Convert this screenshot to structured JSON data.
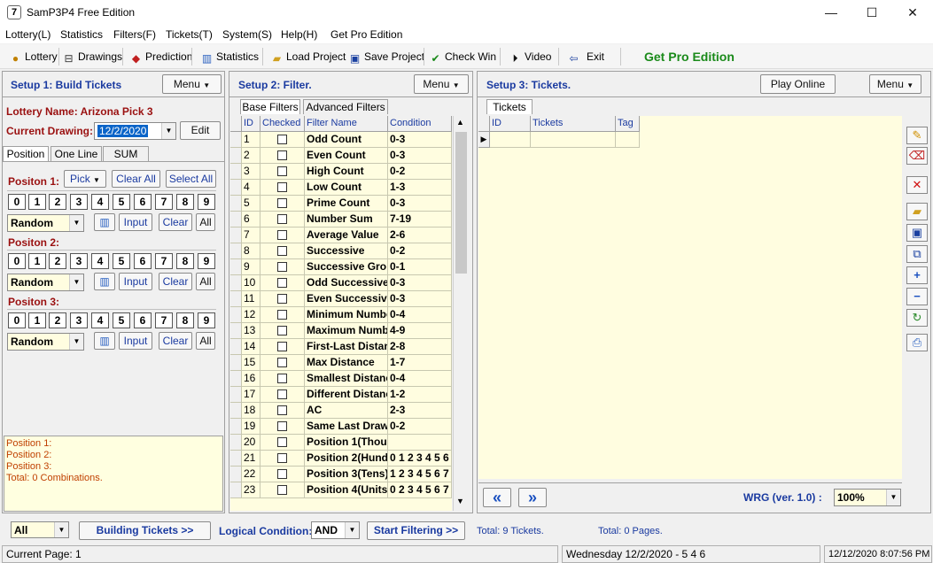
{
  "window": {
    "title": "SamP3P4 Free Edition",
    "minimize": "—",
    "maximize": "☐",
    "close": "✕"
  },
  "menu": [
    "Lottery(L)",
    "Statistics",
    "Filters(F)",
    "Tickets(T)",
    "System(S)",
    "Help(H)",
    "Get Pro Edition"
  ],
  "toolbar": {
    "lottery": "Lottery",
    "drawings": "Drawings",
    "prediction": "Prediction",
    "statistics": "Statistics",
    "load_project": "Load Project",
    "save_project": "Save Project",
    "check_win": "Check Win",
    "video": "Video",
    "exit": "Exit",
    "get_pro": "Get Pro Edition"
  },
  "setup1": {
    "header": "Setup 1: Build  Tickets",
    "menu_label": "Menu",
    "lottery_name": "Lottery  Name: Arizona Pick 3",
    "current_drawing_label": "Current Drawing:",
    "current_drawing_value": "12/2/2020",
    "edit_label": "Edit",
    "tabs": [
      "Position",
      "One Line",
      "SUM"
    ],
    "positions": [
      {
        "label": "Positon 1:",
        "pick": "Pick",
        "clear_all": "Clear All",
        "select_all": "Select All",
        "mode": "Random",
        "input": "Input",
        "clear": "Clear",
        "all": "All"
      },
      {
        "label": "Positon 2:",
        "mode": "Random",
        "input": "Input",
        "clear": "Clear",
        "all": "All"
      },
      {
        "label": "Positon 3:",
        "mode": "Random",
        "input": "Input",
        "clear": "Clear",
        "all": "All"
      }
    ],
    "digits": [
      "0",
      "1",
      "2",
      "3",
      "4",
      "5",
      "6",
      "7",
      "8",
      "9"
    ],
    "summary": [
      "Position 1:",
      "Position 2:",
      "Position 3:",
      "Total: 0 Combinations."
    ]
  },
  "setup2": {
    "header": "Setup 2: Filter.",
    "menu_label": "Menu",
    "tabs": [
      "Base Filters",
      "Advanced Filters"
    ],
    "columns": [
      "ID",
      "Checked",
      "Filter Name",
      "Condition"
    ],
    "rows": [
      [
        "1",
        "Odd Count",
        "0-3"
      ],
      [
        "2",
        "Even Count",
        "0-3"
      ],
      [
        "3",
        "High Count",
        "0-2"
      ],
      [
        "4",
        "Low Count",
        "1-3"
      ],
      [
        "5",
        "Prime Count",
        "0-3"
      ],
      [
        "6",
        "Number Sum",
        "7-19"
      ],
      [
        "7",
        "Average Value",
        "2-6"
      ],
      [
        "8",
        "Successive",
        "0-2"
      ],
      [
        "9",
        "Successive Gro",
        "0-1"
      ],
      [
        "10",
        "Odd Successive",
        "0-3"
      ],
      [
        "11",
        "Even Successiv",
        "0-3"
      ],
      [
        "12",
        "Minimum Numbe",
        "0-4"
      ],
      [
        "13",
        "Maximum Numbe",
        "4-9"
      ],
      [
        "14",
        "First-Last Distan",
        "2-8"
      ],
      [
        "15",
        "Max Distance",
        "1-7"
      ],
      [
        "16",
        "Smallest Distanc",
        "0-4"
      ],
      [
        "17",
        "Different Distanc",
        "1-2"
      ],
      [
        "18",
        "AC",
        "2-3"
      ],
      [
        "19",
        "Same Last Draw",
        "0-2"
      ],
      [
        "20",
        "Position 1(Thous",
        ""
      ],
      [
        "21",
        "Position 2(Hund",
        "0 1 2 3 4 5 6"
      ],
      [
        "22",
        "Position 3(Tens)",
        "1 2 3 4 5 6 7"
      ],
      [
        "23",
        "Position 4(Units",
        "0 2 3 4 5 6 7"
      ]
    ]
  },
  "setup3": {
    "header": "Setup 3: Tickets.",
    "play_online": "Play Online",
    "menu_label": "Menu",
    "tab": "Tickets",
    "columns": [
      "ID",
      "Tickets",
      "Tag"
    ],
    "wrg_label": "WRG (ver. 1.0) :",
    "zoom": "100%",
    "prev": "«",
    "next": "»"
  },
  "bottom": {
    "filter_all": "All",
    "building": "Building  Tickets >>",
    "logical_label": "Logical Condition:",
    "logical_value": "AND",
    "start_filtering": "Start Filtering  >>",
    "total_tickets": "Total: 9 Tickets.",
    "total_pages": "Total: 0 Pages."
  },
  "statusbar": {
    "page": "Current Page: 1",
    "draw": "Wednesday 12/2/2020 - 5 4 6",
    "datetime": "12/12/2020 8:07:56 PM"
  },
  "colors": {
    "accent": "#1a3aa0",
    "grid_bg": "#fffde0",
    "red_label": "#9a1010",
    "summary_orange": "#c04000",
    "pro_green": "#1a8a1a"
  }
}
